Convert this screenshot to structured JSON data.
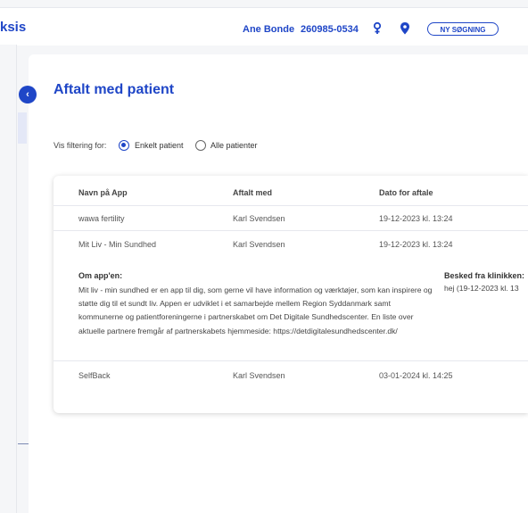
{
  "header": {
    "brand_partial": "ksis",
    "patient_name": "Ane Bonde",
    "cpr": "260985-0534",
    "new_search_label": "NY SØGNING"
  },
  "page": {
    "title": "Aftalt med patient"
  },
  "filter": {
    "label": "Vis filtering for:",
    "options": [
      "Enkelt patient",
      "Alle patienter"
    ],
    "selected": "Enkelt patient"
  },
  "table": {
    "headers": [
      "Navn på App",
      "Aftalt med",
      "Dato for aftale"
    ],
    "rows": [
      {
        "app": "wawa fertility",
        "agreed_with": "Karl Svendsen",
        "date": "19-12-2023 kl. 13:24"
      },
      {
        "app": "Mit Liv - Min Sundhed",
        "agreed_with": "Karl Svendsen",
        "date": "19-12-2023 kl. 13:24"
      },
      {
        "app": "SelfBack",
        "agreed_with": "Karl Svendsen",
        "date": "03-01-2024 kl. 14:25"
      }
    ],
    "details": {
      "about_title": "Om app'en:",
      "about_text": "Mit liv - min sundhed er en app til dig, som gerne vil have information og værktøjer, som kan inspirere og støtte dig til et sundt liv. Appen er udviklet i et samarbejde mellem Region Syddanmark samt kommunerne og patientforeningerne i partnerskabet om Det Digitale Sundhedscenter. En liste over aktuelle partnere fremgår af partnerskabets hjemmeside: https://detdigitalesundhedscenter.dk/",
      "message_title": "Besked fra klinikken:",
      "message_text": "hej  (19-12-2023 kl. 13"
    }
  },
  "icons": {
    "collapse": "chevron-left-icon",
    "gender": "female-symbol-icon",
    "location": "map-pin-icon"
  },
  "colors": {
    "accent": "#1f46c7",
    "background": "#f5f6f8"
  }
}
